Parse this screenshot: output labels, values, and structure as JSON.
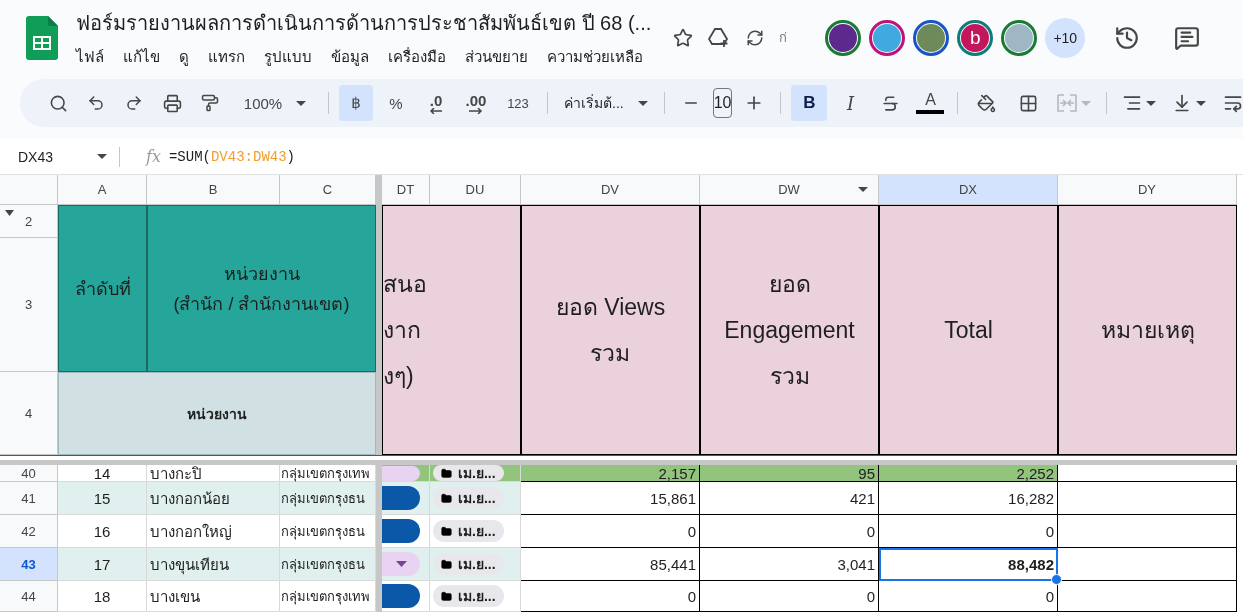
{
  "document": {
    "title": "ฟอร์มรายงานผลการดำเนินการด้านการประชาสัมพันธ์เขต ปี 68 (...",
    "save_status": "ก่"
  },
  "menu": [
    "ไฟล์",
    "แก้ไข",
    "ดู",
    "แทรก",
    "รูปแบบ",
    "ข้อมูล",
    "เครื่องมือ",
    "ส่วนขยาย",
    "ความช่วยเหลือ"
  ],
  "collaborators": [
    {
      "kind": "image",
      "color": "#1b7a34"
    },
    {
      "kind": "image",
      "color": "#c0137a"
    },
    {
      "kind": "image",
      "color": "#1a55c8"
    },
    {
      "kind": "letter",
      "letter": "b",
      "color": "#0f7b7b"
    },
    {
      "kind": "image",
      "color": "#1a7a34"
    }
  ],
  "more_collaborators": "+10",
  "toolbar": {
    "zoom": "100%",
    "currency": {
      "label": "฿",
      "selected": true
    },
    "percent": "%",
    "decrease_decimal": ".0",
    "increase_decimal": ".00",
    "number_format": "123",
    "font": "ค่าเริ่มต้...",
    "font_size": "10",
    "bold": {
      "label": "B",
      "selected": true
    },
    "italic": "I",
    "text_color": "A",
    "merge_disabled": true
  },
  "name_box": "DX43",
  "function_label": "fx",
  "formula": [
    {
      "kind": "plain",
      "text": "=SUM("
    },
    {
      "kind": "range",
      "text": "DV43:DW43"
    },
    {
      "kind": "plain",
      "text": ")"
    }
  ],
  "columns": [
    {
      "label": "A",
      "selected": false,
      "menu": false
    },
    {
      "label": "B",
      "selected": false,
      "menu": false
    },
    {
      "label": "C",
      "selected": false,
      "menu": false
    },
    {
      "label": "DT",
      "selected": false,
      "menu": false
    },
    {
      "label": "DU",
      "selected": false,
      "menu": false
    },
    {
      "label": "DV",
      "selected": false,
      "menu": false
    },
    {
      "label": "DW",
      "selected": false,
      "menu": true
    },
    {
      "label": "DX",
      "selected": true,
      "menu": false
    },
    {
      "label": "DY",
      "selected": false,
      "menu": false
    }
  ],
  "header_rows": [
    {
      "label": "2",
      "collapsible": true
    },
    {
      "label": "3",
      "collapsible": false
    },
    {
      "label": "4",
      "collapsible": false
    }
  ],
  "header": {
    "index": "ลำดับที่",
    "unit": [
      "หน่วยงาน",
      "(สำนัก / สำนักงานเขต)"
    ],
    "unit_sub": "หน่วยงาน",
    "channel": [
      "สนอ",
      "งาก",
      "งๆ)"
    ],
    "views": [
      "ยอด Views",
      "รวม"
    ],
    "engagement": [
      "ยอด",
      "Engagement",
      "รวม"
    ],
    "total": [
      "Total"
    ],
    "note": [
      "หมายเหตุ"
    ]
  },
  "rows": [
    {
      "label": "40",
      "selected": false,
      "banded": false,
      "highlighted": true,
      "number": "14",
      "unit": "บางกะปิ",
      "group": "กลุ่มเขตกรุงเทพ",
      "status": {
        "color": "#e8d3f3",
        "dropdown": false
      },
      "file": "เม.ย...",
      "views": "2,157",
      "engagement": "95",
      "total": "2,252",
      "bold_total": false
    },
    {
      "label": "41",
      "selected": false,
      "banded": true,
      "highlighted": false,
      "number": "15",
      "unit": "บางกอกน้อย",
      "group": "กลุ่มเขตกรุงธน",
      "status": {
        "color": "#0b57a8",
        "dropdown": false
      },
      "file": "เม.ย...",
      "views": "15,861",
      "engagement": "421",
      "total": "16,282",
      "bold_total": false
    },
    {
      "label": "42",
      "selected": false,
      "banded": false,
      "highlighted": false,
      "number": "16",
      "unit": "บางกอกใหญ่",
      "group": "กลุ่มเขตกรุงธน",
      "status": {
        "color": "#0b57a8",
        "dropdown": false
      },
      "file": "เม.ย...",
      "views": "0",
      "engagement": "0",
      "total": "0",
      "bold_total": false
    },
    {
      "label": "43",
      "selected": true,
      "banded": true,
      "highlighted": false,
      "number": "17",
      "unit": "บางขุนเทียน",
      "group": "กลุ่มเขตกรุงธน",
      "status": {
        "color": "#e8d3f3",
        "dropdown": true
      },
      "file": "เม.ย...",
      "views": "85,441",
      "engagement": "3,041",
      "total": "88,482",
      "bold_total": true
    },
    {
      "label": "44",
      "selected": false,
      "banded": false,
      "highlighted": false,
      "number": "18",
      "unit": "บางเขน",
      "group": "กลุ่มเขตกรุงเทพ",
      "status": {
        "color": "#0b57a8",
        "dropdown": false
      },
      "file": "เม.ย...",
      "views": "0",
      "engagement": "0",
      "total": "0",
      "bold_total": false
    }
  ]
}
